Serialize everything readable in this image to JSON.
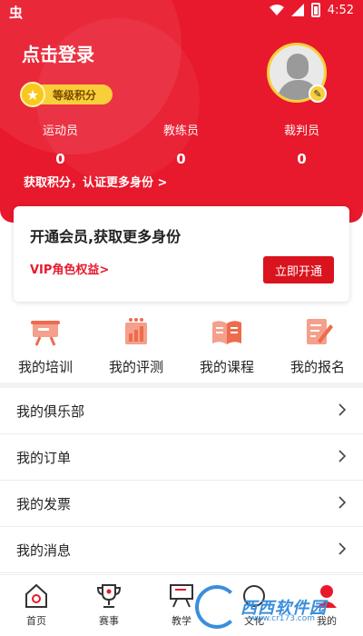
{
  "status_bar": {
    "time": "4:52"
  },
  "header": {
    "login_label": "点击登录",
    "level_label": "等级积分",
    "stats": [
      {
        "label": "运动员",
        "value": "0"
      },
      {
        "label": "教练员",
        "value": "0"
      },
      {
        "label": "裁判员",
        "value": "0"
      }
    ],
    "earn_link": "获取积分，认证更多身份 >"
  },
  "vip": {
    "title": "开通会员,获取更多身份",
    "rights_link": "VIP角色权益>",
    "open_button": "立即开通"
  },
  "quick_actions": [
    {
      "label": "我的培训",
      "icon": "training-board-icon"
    },
    {
      "label": "我的评测",
      "icon": "evaluation-chart-icon"
    },
    {
      "label": "我的课程",
      "icon": "course-book-icon"
    },
    {
      "label": "我的报名",
      "icon": "signup-form-icon"
    }
  ],
  "menu": [
    {
      "label": "我的俱乐部"
    },
    {
      "label": "我的订单"
    },
    {
      "label": "我的发票"
    },
    {
      "label": "我的消息"
    }
  ],
  "bottom_nav": [
    {
      "label": "首页",
      "icon": "home-icon"
    },
    {
      "label": "赛事",
      "icon": "trophy-icon"
    },
    {
      "label": "教学",
      "icon": "teaching-board-icon"
    },
    {
      "label": "文化",
      "icon": "culture-icon"
    },
    {
      "label": "我的",
      "icon": "profile-icon"
    }
  ],
  "watermark": {
    "text": "西西软件园",
    "sub": "www.cr173.com"
  },
  "colors": {
    "primary": "#e8192c",
    "gold": "#f7cf3b",
    "icon_orange": "#ee6b4d"
  }
}
